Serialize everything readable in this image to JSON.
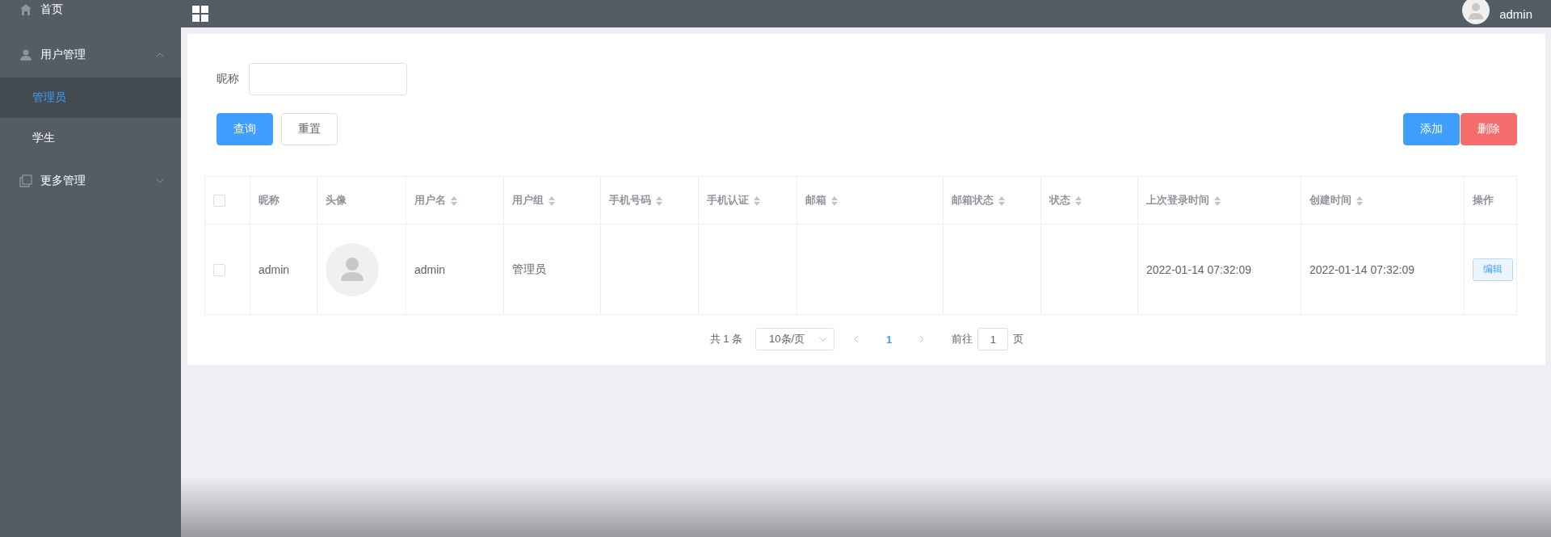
{
  "sidebar": {
    "items": [
      {
        "label": "首页",
        "kind": "link"
      },
      {
        "label": "用户管理",
        "kind": "submenu",
        "expanded": true,
        "children": [
          {
            "label": "管理员",
            "selected": true
          },
          {
            "label": "学生",
            "selected": false
          }
        ]
      },
      {
        "label": "更多管理",
        "kind": "submenu",
        "expanded": false
      }
    ]
  },
  "header": {
    "user_name": "admin"
  },
  "search": {
    "label": "昵称"
  },
  "buttons": {
    "left": [
      {
        "label": "查询",
        "kind": "primary"
      },
      {
        "label": "重置",
        "kind": "plain"
      }
    ],
    "right": [
      {
        "label": "添加",
        "kind": "primary"
      },
      {
        "label": "删除",
        "kind": "danger"
      }
    ]
  },
  "table": {
    "select_all_checked": false,
    "columns": [
      {
        "label": "昵称",
        "sortable": false
      },
      {
        "label": "头像",
        "sortable": false
      },
      {
        "label": "用户名",
        "sortable": true
      },
      {
        "label": "用户组",
        "sortable": true
      },
      {
        "label": "手机号码",
        "sortable": true
      },
      {
        "label": "手机认证",
        "sortable": true
      },
      {
        "label": "邮箱",
        "sortable": true
      },
      {
        "label": "邮箱状态",
        "sortable": true
      },
      {
        "label": "状态",
        "sortable": true
      },
      {
        "label": "上次登录时间",
        "sortable": true
      },
      {
        "label": "创建时间",
        "sortable": true
      },
      {
        "label": "操作",
        "sortable": false
      }
    ],
    "rows": [
      {
        "checked": false,
        "cells": [
          {
            "kind": "text",
            "text": "admin"
          },
          {
            "kind": "avatar"
          },
          {
            "kind": "text",
            "text": "admin"
          },
          {
            "kind": "text",
            "text": "管理员"
          },
          {
            "kind": "empty"
          },
          {
            "kind": "empty"
          },
          {
            "kind": "empty"
          },
          {
            "kind": "empty"
          },
          {
            "kind": "empty"
          },
          {
            "kind": "text",
            "text": "2022-01-14 07:32:09"
          },
          {
            "kind": "text",
            "text": "2022-01-14 07:32:09"
          },
          {
            "kind": "button",
            "text": "编辑"
          }
        ]
      }
    ]
  },
  "pagination": {
    "total": "共 1 条",
    "page_size": "10条/页",
    "prev_disabled": true,
    "next_disabled": true,
    "pages": [
      {
        "label": "1",
        "selected": true
      }
    ],
    "jump_label": "前往",
    "jump_value": "1",
    "jump_suffix": "页"
  }
}
